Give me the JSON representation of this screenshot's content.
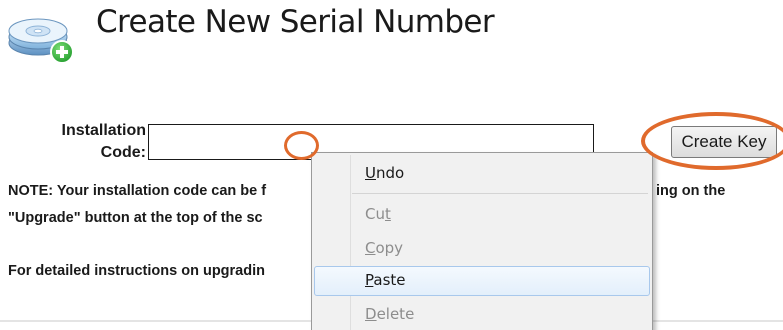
{
  "header": {
    "title": "Create New Serial Number",
    "icon": "disc-add-icon"
  },
  "form": {
    "label_line1": "Installation",
    "label_line2": "Code:",
    "input_value": "",
    "create_key_label": "Create Key"
  },
  "note": {
    "line1": "NOTE: Your installation code can be f",
    "line1_end": "ing on the",
    "line2": "\"Upgrade\" button at the top of the sc"
  },
  "instructions": "For detailed instructions on upgradin",
  "context_menu": {
    "items": [
      {
        "pre": "",
        "ul": "U",
        "post": "ndo",
        "enabled": true
      },
      {
        "pre": "Cu",
        "ul": "t",
        "post": "",
        "enabled": false
      },
      {
        "pre": "",
        "ul": "C",
        "post": "opy",
        "enabled": false
      },
      {
        "pre": "",
        "ul": "P",
        "post": "aste",
        "enabled": true,
        "highlighted": true
      },
      {
        "pre": "",
        "ul": "D",
        "post": "elete",
        "enabled": false
      }
    ]
  },
  "annotations": {
    "color": "#e06a2c"
  }
}
